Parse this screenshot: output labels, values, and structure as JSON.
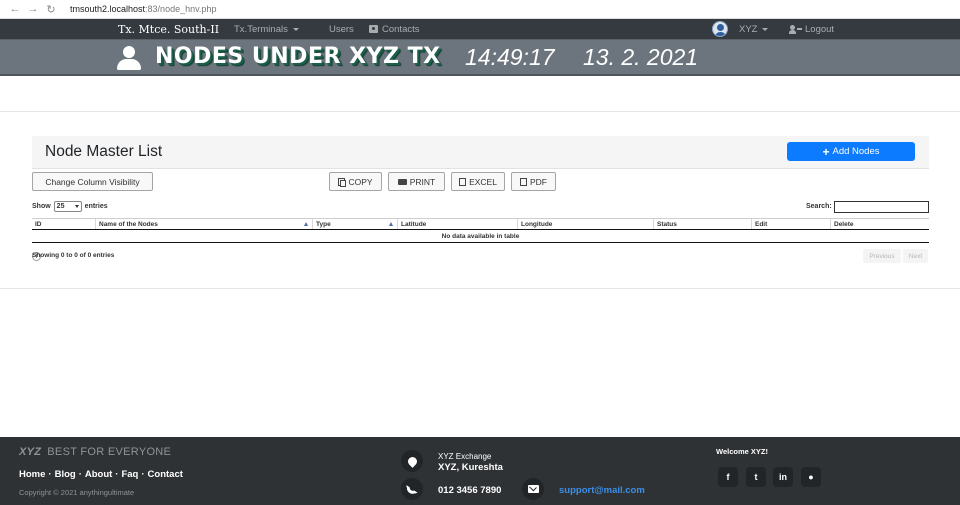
{
  "browser": {
    "back_icon": "back-arrow-icon",
    "forward_icon": "forward-arrow-icon",
    "reload_icon": "reload-icon",
    "url_host": "tmsouth2.localhost",
    "url_path": ":83/node_hnv.php"
  },
  "navbar": {
    "brand": "Tx. Mtce. South-II",
    "terminals": "Tx.Terminals",
    "users": "Users",
    "contacts": "Contacts",
    "user_name": "XYZ",
    "logout": "Logout"
  },
  "banner": {
    "title": "NODES UNDER XYZ TX",
    "time": "14:49:17",
    "date": "13. 2. 2021"
  },
  "card": {
    "title": "Node Master List",
    "add_button": "Add Nodes"
  },
  "toolbar": {
    "column_visibility": "Change Column Visibility",
    "copy": "COPY",
    "print": "PRINT",
    "excel": "EXCEL",
    "pdf": "PDF"
  },
  "table_controls": {
    "show": "Show",
    "page_size": "25",
    "entries": "entries",
    "search_label": "Search:",
    "search_value": ""
  },
  "table": {
    "columns": [
      "ID",
      "Name of the Nodes",
      "Type",
      "Latitude",
      "Longitude",
      "Status",
      "Edit",
      "Delete"
    ],
    "empty_message": "No data available in table",
    "info": "Showing 0 to 0 of 0 entries",
    "previous": "Previous",
    "next": "Next"
  },
  "footer": {
    "logo": "XYZ",
    "tagline": "BEST FOR EVERYONE",
    "links": [
      "Home",
      "Blog",
      "About",
      "Faq",
      "Contact"
    ],
    "copyright": "Copyright © 2021 anythingultimate",
    "address_line1": "XYZ Exchange",
    "address_line2": "XYZ, Kureshta",
    "phone": "012 3456 7890",
    "email": "support@mail.com",
    "welcome": "Welcome XYZ!",
    "social_icons": [
      "facebook-icon",
      "twitter-icon",
      "linkedin-icon",
      "github-icon"
    ]
  }
}
